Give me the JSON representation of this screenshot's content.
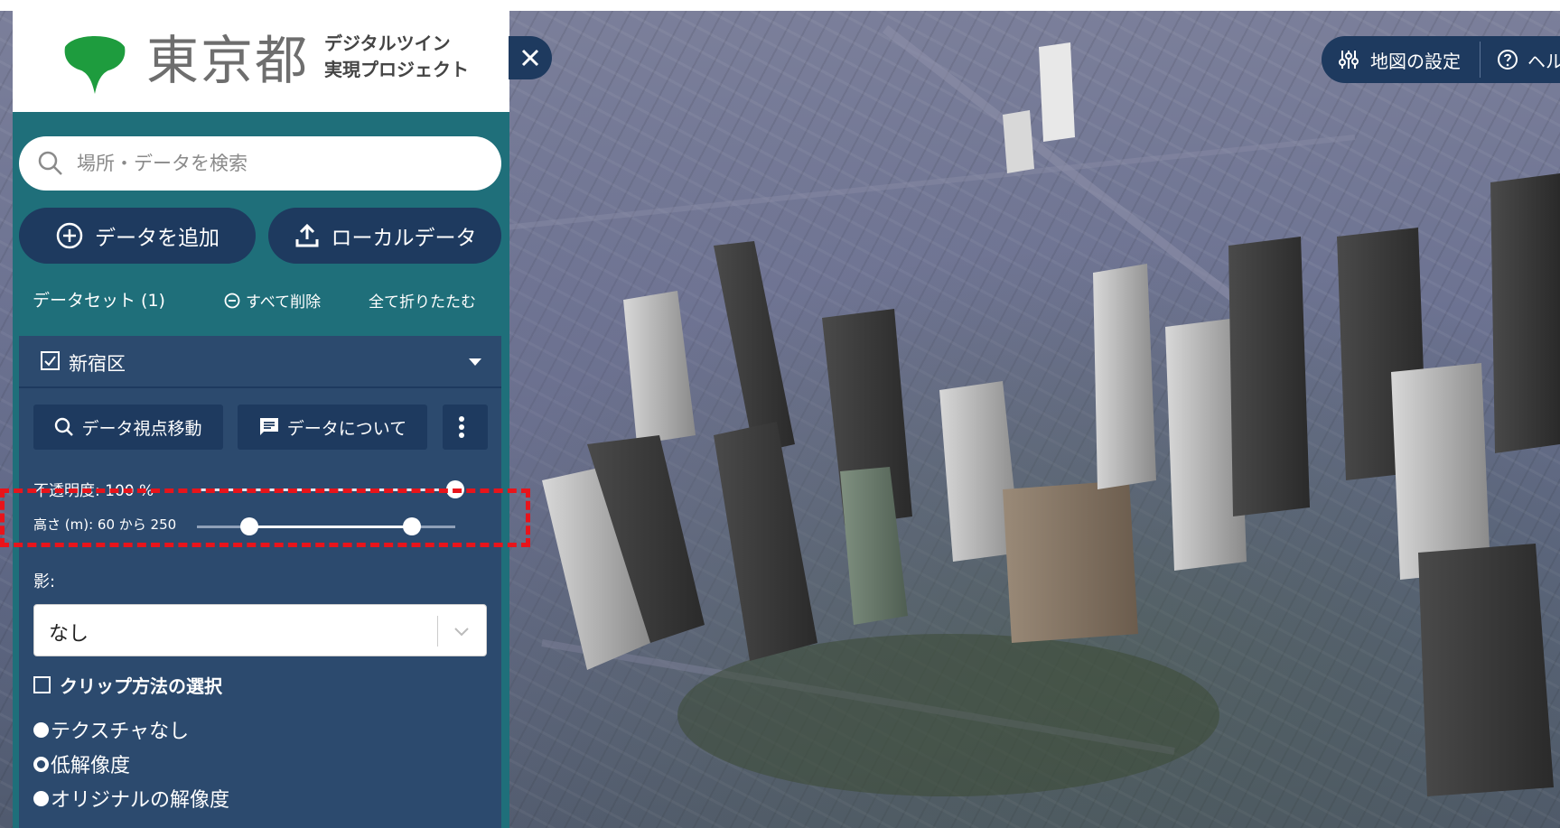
{
  "logo": {
    "title": "東京都",
    "subtitle_line1": "デジタルツイン",
    "subtitle_line2": "実現プロジェクト"
  },
  "search": {
    "placeholder": "場所・データを検索"
  },
  "buttons": {
    "add_data": "データを追加",
    "local_data": "ローカルデータ"
  },
  "datasets": {
    "title": "データセット (1)",
    "remove_all": "すべて削除",
    "collapse_all": "全て折りたたむ"
  },
  "layer": {
    "name": "新宿区",
    "checked": true,
    "zoom_to_data": "データ視点移動",
    "about_data": "データについて",
    "opacity_label": "不透明度: 100 %",
    "opacity_value": 100,
    "height_label": "高さ (m): 60 から 250",
    "height_min": 60,
    "height_max": 250,
    "shadow_label": "影:",
    "shadow_value": "なし",
    "clip_label": "クリップ方法の選択",
    "texture_options": [
      {
        "label": "テクスチャなし",
        "selected": false
      },
      {
        "label": "低解像度",
        "selected": true
      },
      {
        "label": "オリジナルの解像度",
        "selected": false
      }
    ]
  },
  "map_controls": {
    "settings": "地図の設定",
    "help": "ヘル"
  },
  "colors": {
    "panel_teal": "#1f6f7a",
    "navy": "#1e3a5f",
    "card_blue": "#2c4a6e",
    "logo_green": "#1e9c3e",
    "highlight_red": "#e8141b"
  }
}
